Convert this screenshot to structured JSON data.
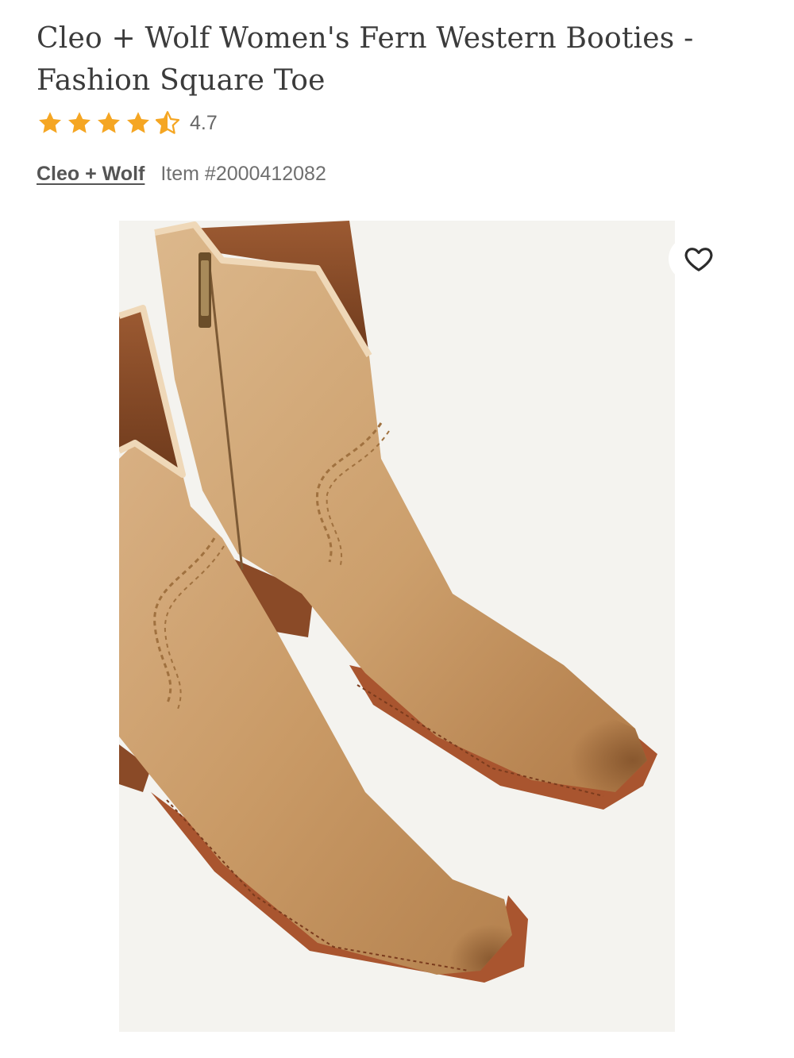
{
  "product": {
    "title": "Cleo + Wolf Women's Fern Western Booties - Fashion Square Toe",
    "rating": 4.7,
    "rating_label": "4.7",
    "rating_max": 5,
    "brand_label": "Cleo + Wolf",
    "item_number_label": "Item #2000412082",
    "image_alt": "Cleo + Wolf Women's Fern Western Booties - Fashion Square Toe"
  },
  "icons": {
    "star": "star-icon",
    "wishlist": "heart-icon"
  },
  "colors": {
    "star": "#f5a623",
    "text_primary": "#3b3b3b",
    "text_secondary": "#6f6f6f",
    "image_background": "#f4f3ef",
    "boot_leather": "#c89a67",
    "boot_sole": "#a9552f"
  }
}
